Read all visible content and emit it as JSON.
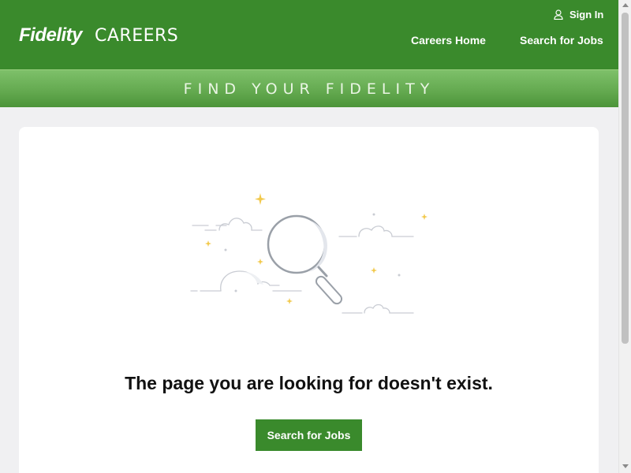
{
  "header": {
    "brand": "Fidelity",
    "section": "CAREERS",
    "sign_in": "Sign In",
    "nav": {
      "careers_home": "Careers Home",
      "search_jobs": "Search for Jobs"
    }
  },
  "banner": {
    "tagline": "FIND YOUR FIDELITY"
  },
  "main": {
    "message": "The page you are looking for doesn't exist.",
    "cta_label": "Search for Jobs"
  },
  "icons": {
    "user": "user-icon",
    "magnifier": "magnifying-glass-illustration"
  },
  "colors": {
    "brand_green": "#3a8a2c",
    "banner_green": "#62a84e",
    "page_bg": "#f0f0f2",
    "sparkle": "#f2c94c"
  }
}
